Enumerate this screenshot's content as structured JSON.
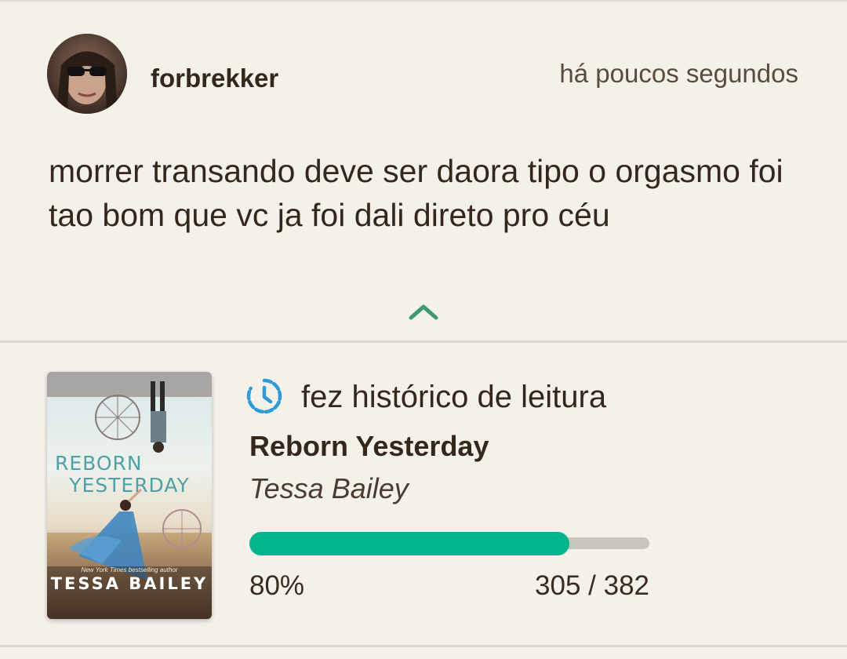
{
  "post": {
    "username": "forbrekker",
    "timestamp": "há poucos segundos",
    "text": "morrer transando deve ser daora tipo o orgasmo foi tao bom que vc ja foi dali direto pro céu"
  },
  "reading_update": {
    "activity_label": "fez histórico de leitura",
    "book": {
      "title": "Reborn Yesterday",
      "author": "Tessa Bailey",
      "cover": {
        "title_line1": "REBORN",
        "title_line2": "YESTERDAY",
        "tagline": "New York Times bestselling author",
        "author": "TESSA BAILEY"
      }
    },
    "progress": {
      "fraction": 0.8,
      "percent_label": "80%",
      "pages_label": "305 / 382"
    }
  },
  "colors": {
    "background": "#f4f1eb",
    "accent_green": "#00b58c",
    "chevron_green": "#3d9a6e",
    "history_icon_blue": "#2f9ad8",
    "text_dark": "#34271c"
  }
}
